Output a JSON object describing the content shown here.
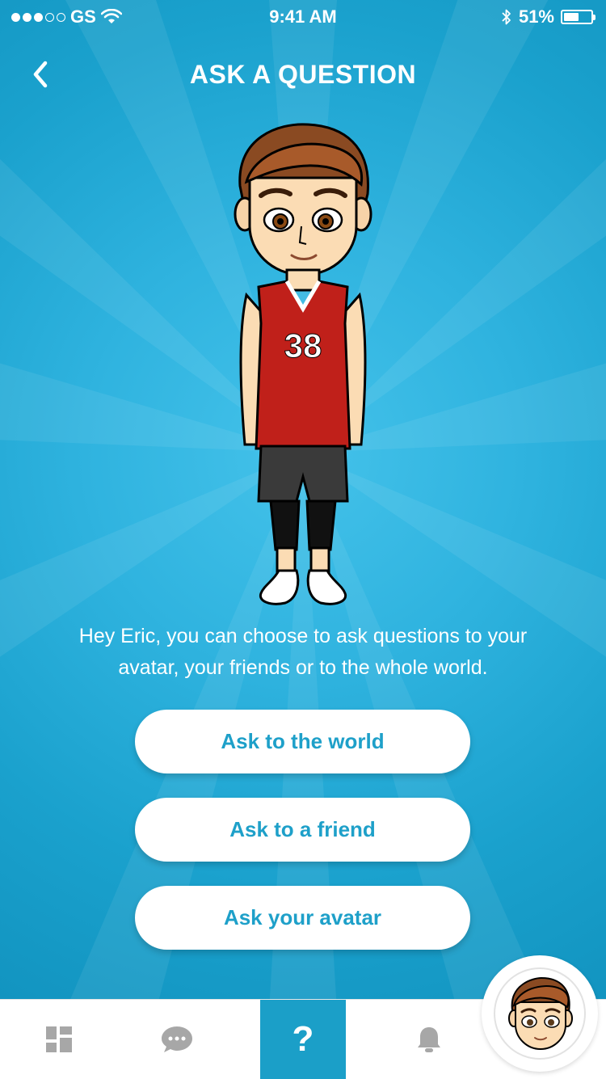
{
  "status_bar": {
    "carrier": "GS",
    "time": "9:41 AM",
    "battery_percent": "51%",
    "battery_level": 0.51,
    "signal_strength": "3 of 5"
  },
  "header": {
    "title": "ASK A QUESTION",
    "back_icon": "chevron-left-icon"
  },
  "avatar": {
    "jersey_number": "38",
    "jersey_color": "#c0201a"
  },
  "intro": {
    "text": "Hey Eric, you can choose to ask questions to your avatar, your friends or to the whole world."
  },
  "actions": {
    "world": "Ask to the world",
    "friend": "Ask to a friend",
    "avatar": "Ask your avatar"
  },
  "tab_bar": {
    "tabs": [
      {
        "icon": "dashboard-grid-icon",
        "active": false
      },
      {
        "icon": "chat-bubble-icon",
        "active": false
      },
      {
        "icon": "question-mark-icon",
        "label": "?",
        "active": true
      },
      {
        "icon": "bell-icon",
        "active": false
      }
    ],
    "profile_icon": "avatar-face-icon"
  },
  "colors": {
    "background": "#2fb3df",
    "accent": "#1ea0c9",
    "active_tab": "#1b9fc8"
  }
}
